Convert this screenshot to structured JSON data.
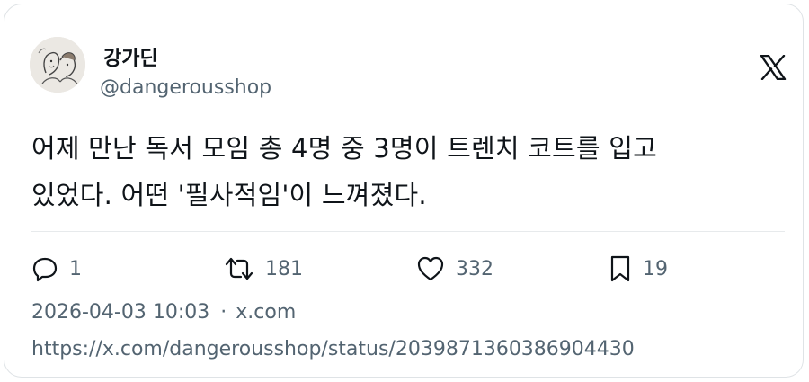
{
  "author": {
    "display_name": "강가딘",
    "handle": "@dangerousshop",
    "avatar_icon": "sketch-portrait-avatar"
  },
  "brand_icon": "x-logo-icon",
  "tweet": {
    "line1": "어제 만난 독서 모임 총 4명 중 3명이 트렌치 코트를 입고",
    "line2": "있었다. 어떤 '필사적임'이 느껴졌다."
  },
  "actions": {
    "reply": {
      "icon": "reply-icon",
      "count": "1"
    },
    "retweet": {
      "icon": "retweet-icon",
      "count": "181"
    },
    "like": {
      "icon": "heart-icon",
      "count": "332"
    },
    "bookmark": {
      "icon": "bookmark-icon",
      "count": "19"
    }
  },
  "meta": {
    "timestamp": "2026-04-03 10:03",
    "separator": "·",
    "source": "x.com"
  },
  "url": "https://x.com/dangerousshop/status/2039871360386904430",
  "colors": {
    "text_primary": "#0f1419",
    "text_secondary": "#536471",
    "border": "#dfe3e6"
  }
}
